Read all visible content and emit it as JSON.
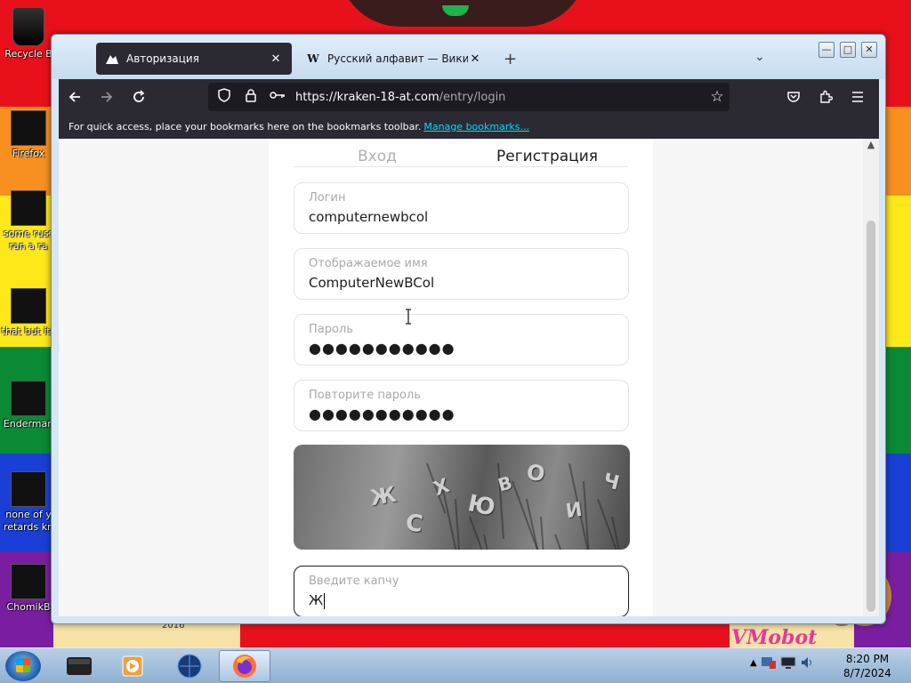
{
  "desktop": {
    "icons": [
      {
        "label": "Recycle B",
        "icon": "recycle-bin-icon"
      },
      {
        "label": "Firefox",
        "icon": "firefox-icon"
      },
      {
        "label": "some russ",
        "label2": "ran a ra",
        "icon": "shortcut-icon"
      },
      {
        "label": "that but its",
        "icon": "folder-icon"
      },
      {
        "label": "Enderman",
        "icon": "app-icon"
      },
      {
        "label": "none of y",
        "label2": "retards kn",
        "icon": "shortcut-icon"
      },
      {
        "label": "ChomikB",
        "icon": "app-icon"
      }
    ],
    "wallpaper_text": "VMobot",
    "year_text": "2016"
  },
  "browser": {
    "tabs": [
      {
        "title": "Авторизация",
        "active": true
      },
      {
        "title": "Русский алфавит — Википеди",
        "active": false
      }
    ],
    "new_tab": "+",
    "url_host": "https://kraken-18-at.com",
    "url_path": "/entry/login",
    "bookmarks_bar": {
      "text": "For quick access, place your bookmarks here on the bookmarks toolbar.",
      "link": "Manage bookmarks..."
    }
  },
  "page": {
    "tab_login": "Вход",
    "tab_register": "Регистрация",
    "fields": [
      {
        "label": "Логин",
        "value": "computernewbcol"
      },
      {
        "label": "Отображаемое имя",
        "value": "ComputerNewBCol"
      },
      {
        "label": "Пароль",
        "value": "●●●●●●●●●●●"
      },
      {
        "label": "Повторите пароль",
        "value": "●●●●●●●●●●●"
      }
    ],
    "captcha_chars": [
      "Ж",
      "С",
      "Х",
      "Ю",
      "В",
      "О",
      "И",
      "Ч"
    ],
    "captcha_input": {
      "label": "Введите капчу",
      "value": "Ж"
    }
  },
  "taskbar": {
    "time": "8:20 PM",
    "date": "8/7/2024"
  }
}
